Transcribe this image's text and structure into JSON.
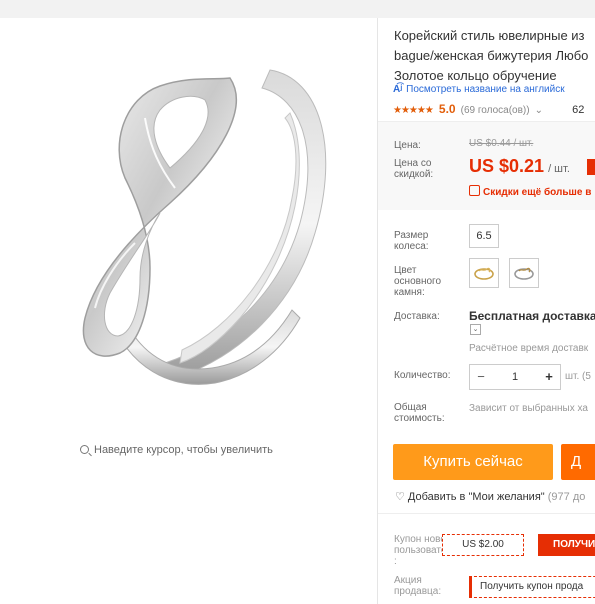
{
  "product": {
    "title_lines": [
      "Корейский стиль ювелирные из",
      "bague/женская бижутерия Любо",
      "Золотое кольцо обручение"
    ],
    "translate_link": "Посмотреть название на английск",
    "rating": {
      "stars": "★★★★★",
      "score": "5.0",
      "votes": "(69 голоса(ов))",
      "orders": "62"
    }
  },
  "price": {
    "price_label": "Цена:",
    "old_price": "US $0.44 / шт.",
    "discount_label_lines": [
      "Цена со",
      "скидкой:"
    ],
    "new_price": "US $0.21",
    "unit": "/ шт.",
    "discount_link": "Скидки ещё больше в"
  },
  "options": {
    "size_label_lines": [
      "Размер",
      "колеса:"
    ],
    "size_value": "6.5",
    "color_label_lines": [
      "Цвет",
      "основного",
      "камня:"
    ],
    "delivery_label": "Доставка:",
    "delivery_value": "Бесплатная доставка в",
    "delivery_time": "Расчётное время доставк",
    "quantity_label": "Количество:",
    "quantity_minus": "−",
    "quantity_value": "1",
    "quantity_plus": "+",
    "quantity_unit": "шт. (5",
    "total_label_lines": [
      "Общая",
      "стоимость:"
    ],
    "total_value": "Зависит от выбранных ха"
  },
  "actions": {
    "buy_now": "Купить сейчас",
    "second_button": "Д",
    "wishlist": "Добавить в \"Мои желания\"",
    "wishlist_count": "(977 до"
  },
  "coupons": {
    "new_user_label_lines": [
      "Купон нового",
      "пользователя",
      ":"
    ],
    "new_user_amount": "US $2.00",
    "new_user_button": "ПОЛУЧИ",
    "seller_label_lines": [
      "Акция",
      "продавца:"
    ],
    "seller_coupon": "Получить купон прода"
  },
  "gallery": {
    "zoom_hint": "Наведите курсор, чтобы увеличить"
  },
  "colors": {
    "price_red": "#e62e04",
    "buy_orange": "#ff9a1a",
    "link_blue": "#2a6ad8",
    "star_orange": "#e25e0a"
  }
}
